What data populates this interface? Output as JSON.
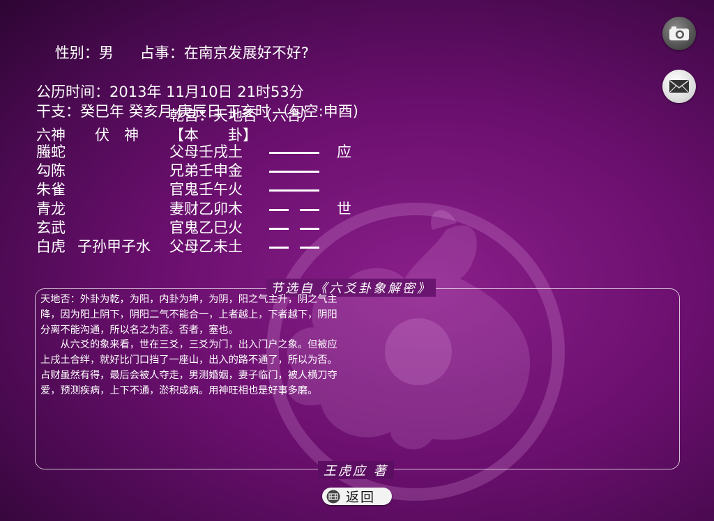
{
  "header": {
    "gender": "性别：男",
    "question": "占事：在南京发展好不好?",
    "date": "公历时间：2013年 11月10日 21时53分",
    "ganzhi": "干支：癸巳年 癸亥月 庚辰日 丁亥时 （旬空:申酉)"
  },
  "gua": {
    "title": "乾宫：天地否（六合）",
    "col_liushen": "六神",
    "col_fushen": "伏　神",
    "col_bengua": "【本　　卦】",
    "rows": [
      {
        "liushen": "螣蛇",
        "fushen": "",
        "yao": "父母壬戌土",
        "line": "solid",
        "mark": "应"
      },
      {
        "liushen": "勾陈",
        "fushen": "",
        "yao": "兄弟壬申金",
        "line": "solid",
        "mark": ""
      },
      {
        "liushen": "朱雀",
        "fushen": "",
        "yao": "官鬼壬午火",
        "line": "solid",
        "mark": ""
      },
      {
        "liushen": "青龙",
        "fushen": "",
        "yao": "妻财乙卯木",
        "line": "broken",
        "mark": "世"
      },
      {
        "liushen": "玄武",
        "fushen": "",
        "yao": "官鬼乙巳火",
        "line": "broken",
        "mark": ""
      },
      {
        "liushen": "白虎",
        "fushen": "子孙甲子水",
        "yao": "父母乙未土",
        "line": "broken",
        "mark": ""
      }
    ]
  },
  "panel": {
    "title": "节选自《六爻卦象解密》",
    "paragraph1": "天地否：外卦为乾，为阳，内卦为坤，为阴，阳之气主升，阴之气主降，因为阳上阴下，阴阳二气不能合一，上者越上，下者越下，阴阳分离不能沟通，所以名之为否。否者，塞也。",
    "paragraph2": "从六爻的象来看，世在三爻，三爻为门，出入门户之象。但被应上戌土合绊，就好比门口挡了一座山，出入的路不通了，所以为否。占财虽然有得，最后会被人夺走，男测婚姻，妻子临门，被人横刀夺爱，预测疾病，上下不通，淤积成病。用神旺相也是好事多磨。",
    "author": "王虎应 著"
  },
  "buttons": {
    "return_label": "返回"
  },
  "icons": {
    "camera": "camera-icon",
    "mail": "mail-icon",
    "knot": "endless-knot-icon"
  },
  "colors": {
    "background": "#6a0f6e",
    "text": "#ffffff"
  }
}
